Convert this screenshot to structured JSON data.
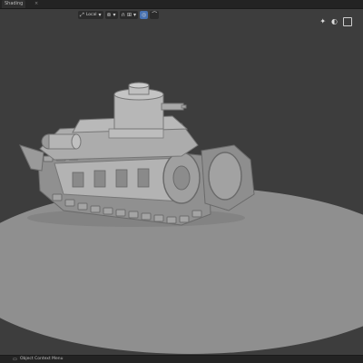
{
  "topbar": {
    "tab_label": "Shading",
    "tab_close": "×"
  },
  "header": {
    "orientation_label": "Local",
    "orientation_icon": "axis-icon",
    "snap_icon": "magnet-icon",
    "proportional_icon": "circle-dot-icon"
  },
  "viewport_tools": {
    "gizmo_icon": "gizmo-icon",
    "overlay_icon": "overlay-icon",
    "xray_icon": "xray-icon"
  },
  "status": {
    "label": "Object Context Menu"
  },
  "colors": {
    "background": "#3d3d3d",
    "floor": "#8d8d8d",
    "model": "#a9a9a9",
    "active": "#4772b3"
  }
}
